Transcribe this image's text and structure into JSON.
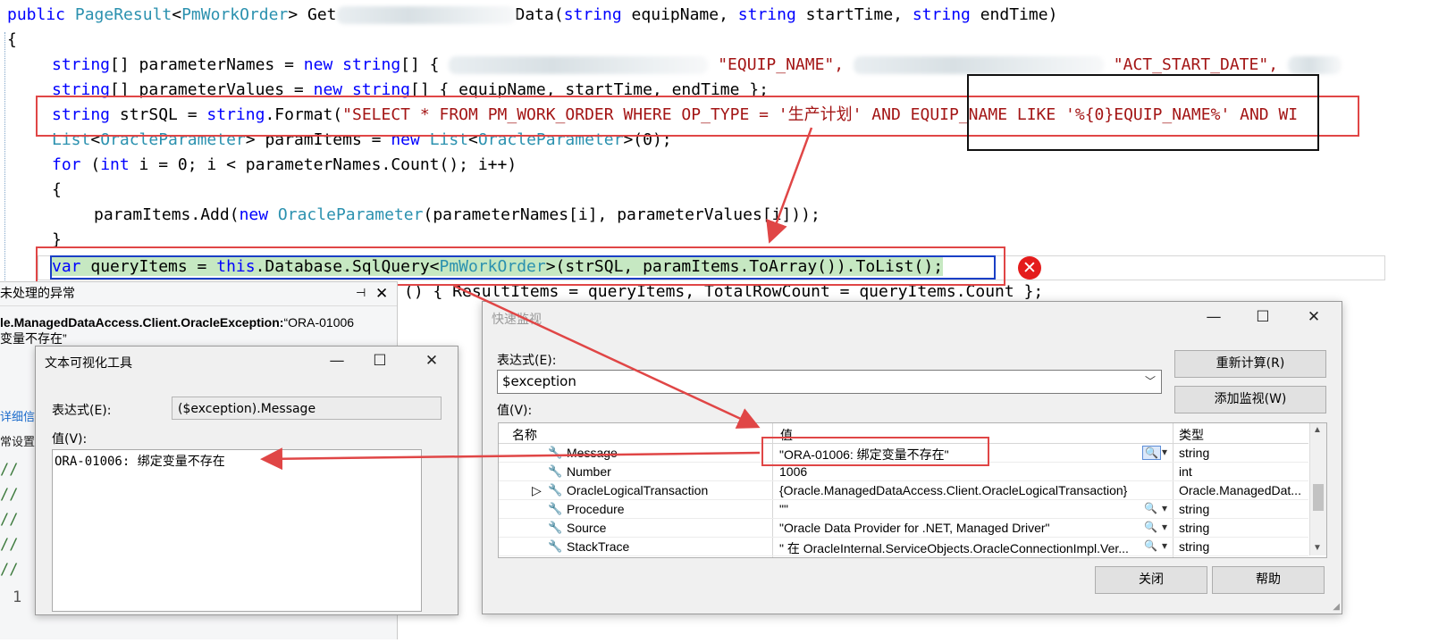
{
  "editor": {
    "method_sig": {
      "p1": "public",
      "p2": "PageResult",
      "p3": "<",
      "p4": "PmWorkOrder",
      "p5": "> Get",
      "p6": "Data(",
      "p7": "string",
      "p8": " equipName, ",
      "p9": "string",
      "p10": " startTime, ",
      "p11": "string",
      "p12": " endTime)"
    },
    "brace_open": "{",
    "names_line": {
      "t1": "string",
      "t2": "[] parameterNames = ",
      "t3": "new",
      "t4": " ",
      "t5": "string",
      "t6": "[] {",
      "s1": "\"EQUIP_NAME\",",
      "s2": "\"ACT_START_DATE\","
    },
    "values_line": {
      "t1": "string",
      "t2": "[] parameterValues = ",
      "t3": "new",
      "t4": " ",
      "t5": "string",
      "t6": "[] { equipName, startTime, endTime };"
    },
    "sql_line": {
      "t1": "string",
      "t2": " strSQL = ",
      "t3": "string",
      "t4": ".Format(",
      "s1": "\"SELECT * FROM PM_WORK_ORDER WHERE OP_TYPE = '生产计划' AND EQUIP_NAME LIKE '%{0}EQUIP_NAME%' AND WI"
    },
    "list_line": {
      "t1": "List",
      "t2": "<",
      "t3": "OracleParameter",
      "t4": "> paramItems = ",
      "t5": "new",
      "t6": " ",
      "t7": "List",
      "t8": "<",
      "t9": "OracleParameter",
      "t10": ">(0);"
    },
    "for_line": {
      "t1": "for",
      "t2": " (",
      "t3": "int",
      "t4": " i = 0; i < parameterNames.Count(); i++)"
    },
    "brace2_open": "{",
    "add_line": {
      "t1": "paramItems.Add(",
      "t2": "new",
      "t3": " ",
      "t4": "OracleParameter",
      "t5": "(parameterNames[i], parameterValues[i]));"
    },
    "brace2_close": "}",
    "query_line": {
      "t1": "var",
      "t2": " queryItems = ",
      "t3": "this",
      "t4": ".Database.SqlQuery<",
      "t5": "PmWorkOrder",
      "t6": ">(strSQL, paramItems.ToArray()).ToList();"
    },
    "result_line": "() { ResultItems = queryItems, TotalRowCount = queryItems.Count };",
    "error_glyph": "✕",
    "comment_prefix": "//",
    "line_number": "1"
  },
  "exception_helper": {
    "title": "未处理的异常",
    "pin_icon": "⊣",
    "close_icon": "✕",
    "message_bold": "le.ManagedDataAccess.Client.OracleException:",
    "message_rest": "“ORA-01006",
    "message_line2": "变量不存在”",
    "detail_link": "详细信",
    "settings": "常设置"
  },
  "text_visualizer": {
    "title": "文本可视化工具",
    "min_icon": "—",
    "max_icon": "☐",
    "close_icon": "✕",
    "expr_label": "表达式(E):",
    "expr_value": "($exception).Message",
    "value_label": "值(V):",
    "value_text": "ORA-01006: 绑定变量不存在"
  },
  "quick_watch": {
    "title": "快速监视",
    "min_icon": "—",
    "max_icon": "☐",
    "close_icon": "✕",
    "expr_label": "表达式(E):",
    "expr_value": "$exception",
    "value_label": "值(V):",
    "recalc_button": "重新计算(R)",
    "add_watch_button": "添加监视(W)",
    "close_button": "关闭",
    "help_button": "帮助",
    "columns": {
      "name": "名称",
      "value": "值",
      "type": "类型"
    },
    "rows": [
      {
        "expander": "",
        "name": "Message",
        "value": "\"ORA-01006: 绑定变量不存在\"",
        "type": "string"
      },
      {
        "expander": "",
        "name": "Number",
        "value": "1006",
        "type": "int"
      },
      {
        "expander": "▷",
        "name": "OracleLogicalTransaction",
        "value": "{Oracle.ManagedDataAccess.Client.OracleLogicalTransaction}",
        "type": "Oracle.ManagedDat..."
      },
      {
        "expander": "",
        "name": "Procedure",
        "value": "\"\"",
        "type": "string"
      },
      {
        "expander": "",
        "name": "Source",
        "value": "\"Oracle Data Provider for .NET, Managed Driver\"",
        "type": "string"
      },
      {
        "expander": "",
        "name": "StackTrace",
        "value": "\"   在 OracleInternal.ServiceObjects.OracleConnectionImpl.Ver...",
        "type": "string"
      }
    ]
  },
  "colors": {
    "keyword": "#0000ff",
    "type": "#2b91af",
    "string": "#a31515",
    "annotation_red": "#e04646",
    "statement_highlight": "#c6e8c2",
    "error": "#e41c1c"
  }
}
